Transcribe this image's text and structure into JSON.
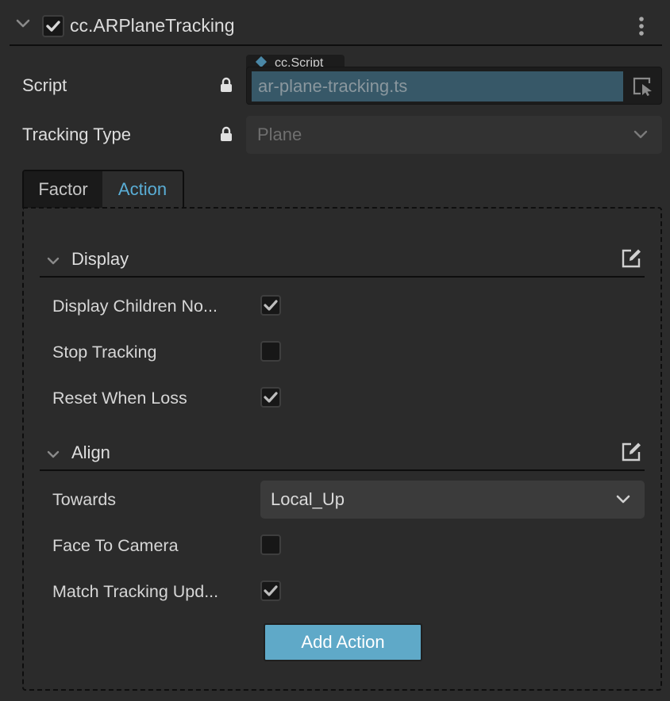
{
  "component": {
    "title": "cc.ARPlaneTracking",
    "enabled": true,
    "icons": {
      "collapse": "chevron-down-icon",
      "menu": "more-vertical-icon"
    }
  },
  "properties": {
    "script": {
      "label": "Script",
      "locked": true,
      "type_tag": "cc.Script",
      "value": "ar-plane-tracking.ts",
      "pick_icon": "select-asset-icon"
    },
    "tracking_type": {
      "label": "Tracking Type",
      "locked": true,
      "value": "Plane"
    }
  },
  "tabs": [
    {
      "label": "Factor",
      "active": false
    },
    {
      "label": "Action",
      "active": true
    }
  ],
  "sections": {
    "display": {
      "title": "Display",
      "rows": [
        {
          "label": "Display Children No...",
          "checked": true
        },
        {
          "label": "Stop Tracking",
          "checked": false
        },
        {
          "label": "Reset When Loss",
          "checked": true
        }
      ]
    },
    "align": {
      "title": "Align",
      "towards": {
        "label": "Towards",
        "value": "Local_Up"
      },
      "rows": [
        {
          "label": "Face To Camera",
          "checked": false
        },
        {
          "label": "Match Tracking Upd...",
          "checked": true
        }
      ]
    }
  },
  "buttons": {
    "add_action": "Add Action"
  },
  "colors": {
    "background": "#2b2b2b",
    "accent": "#5aaed6",
    "button": "#5fa9c8",
    "script_value_bg": "#375868"
  }
}
